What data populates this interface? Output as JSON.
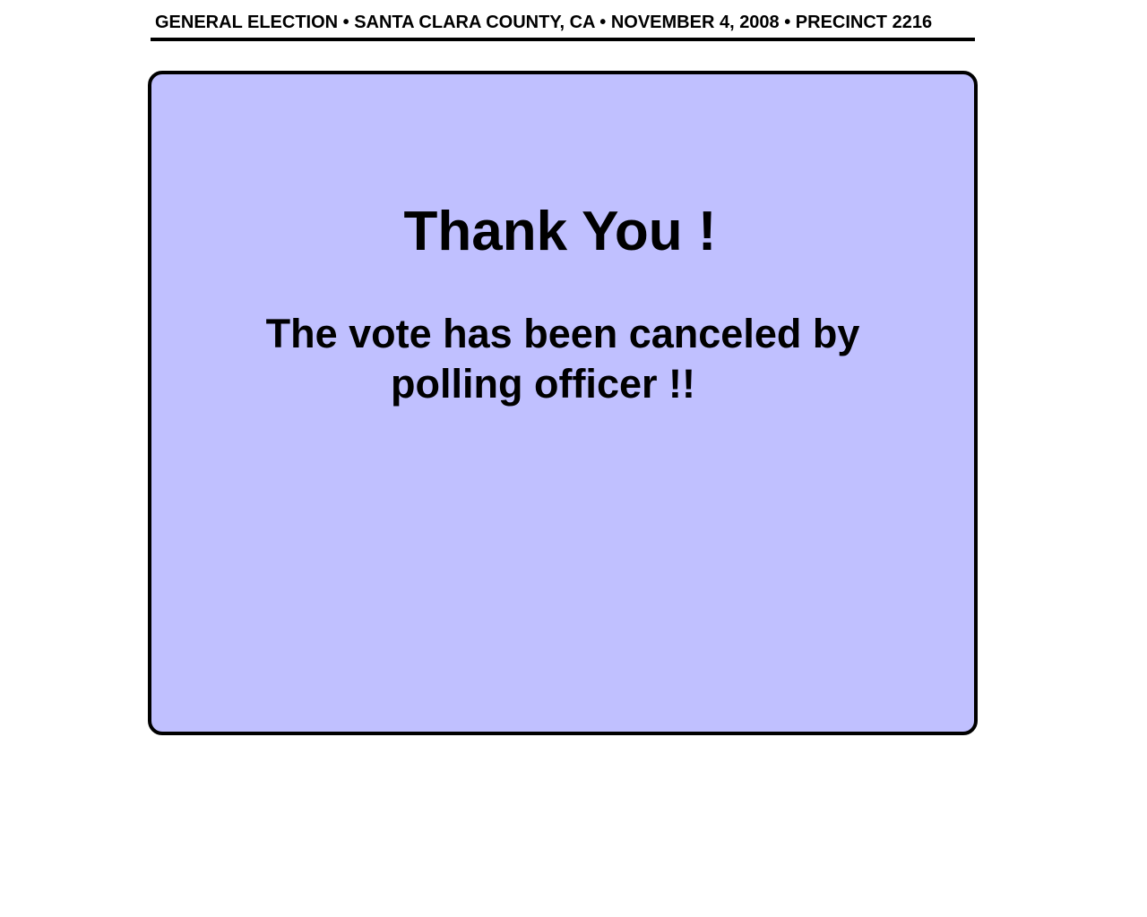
{
  "header": {
    "text": "GENERAL ELECTION • SANTA CLARA COUNTY, CA • NOVEMBER 4, 2008 • PRECINCT 2216"
  },
  "panel": {
    "title": "Thank You !",
    "message_line_1": "The vote has been canceled by",
    "message_line_2": "polling officer !!"
  },
  "colors": {
    "panel_background": "#c0c0ff",
    "border": "#000000",
    "page_background": "#ffffff"
  }
}
